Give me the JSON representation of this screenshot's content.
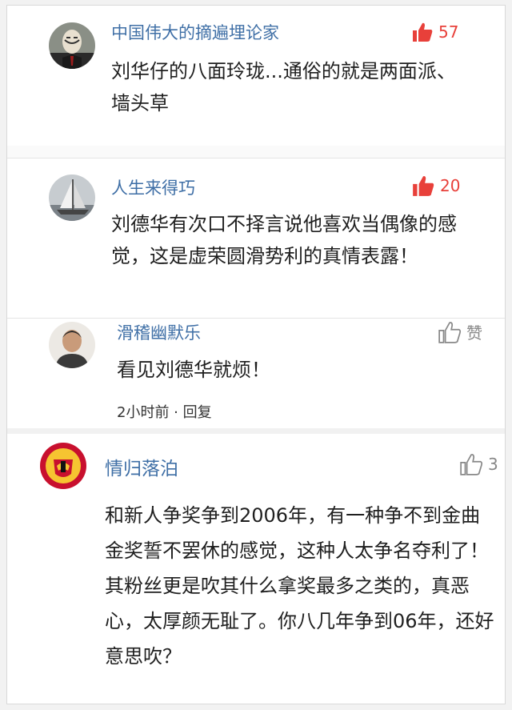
{
  "comments": [
    {
      "user": "中国伟大的摘遍埋论家",
      "likes": "57",
      "text": "刘华仔的八面玲珑...通俗的就是两面派、墙头草",
      "avatar_icon": "masked-man-avatar-icon",
      "like_color": "#e8403a"
    },
    {
      "user": "人生来得巧",
      "likes": "20",
      "text": "刘德华有次口不择言说他喜欢当偶像的感觉，这是虚荣圆滑势利的真情表露！",
      "avatar_icon": "sailboat-avatar-icon",
      "like_color": "#e8403a"
    },
    {
      "user": "滑稽幽默乐",
      "likes": "赞",
      "text": "看见刘德华就烦！",
      "meta": "2小时前 · 回复",
      "avatar_icon": "man-portrait-avatar-icon",
      "like_color": "#888888"
    },
    {
      "user": "情归落泊",
      "likes": "3",
      "text": "和新人争奖争到2006年，有一种争不到金曲金奖誓不罢休的感觉，这种人太争名夺利了！其粉丝更是吹其什么拿奖最多之类的，真恶心，太厚颜无耻了。你八几年争到06年，还好意思吹？",
      "avatar_icon": "manchester-united-badge-avatar-icon",
      "like_color": "#888888"
    }
  ]
}
